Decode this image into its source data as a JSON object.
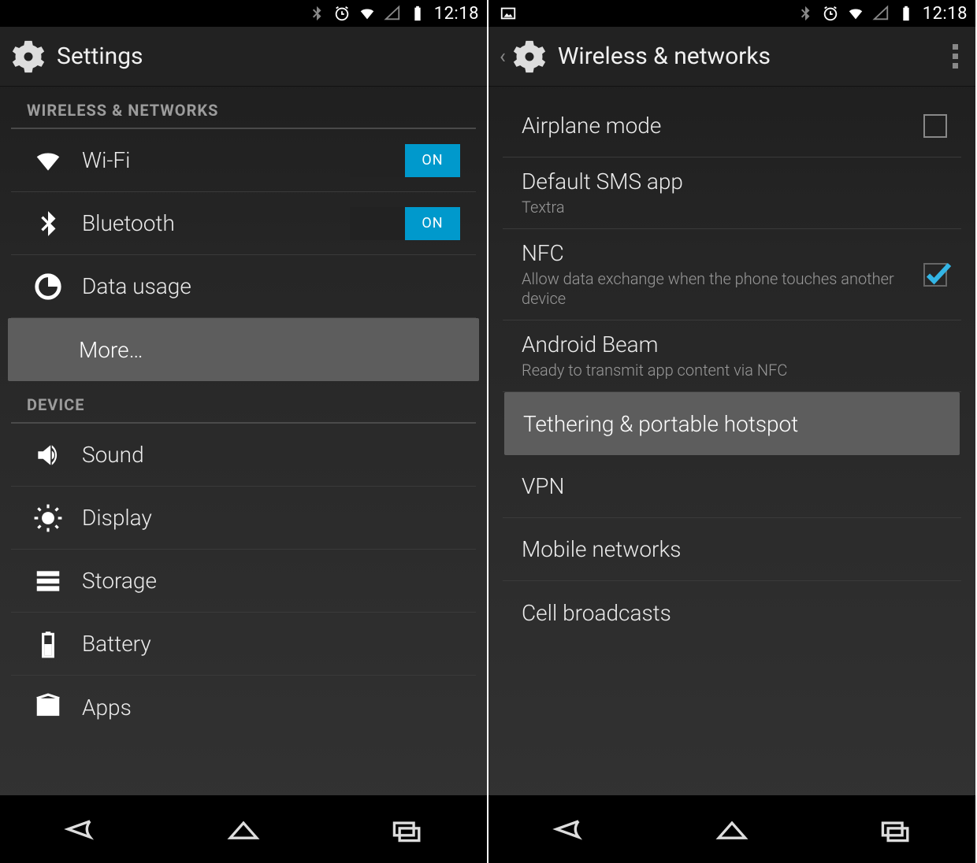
{
  "status": {
    "time": "12:18"
  },
  "left": {
    "title": "Settings",
    "section_wireless": "WIRELESS & NETWORKS",
    "section_device": "DEVICE",
    "items": {
      "wifi": "Wi-Fi",
      "bluetooth": "Bluetooth",
      "data_usage": "Data usage",
      "more": "More…",
      "sound": "Sound",
      "display": "Display",
      "storage": "Storage",
      "battery": "Battery",
      "apps": "Apps"
    },
    "toggles": {
      "wifi": "ON",
      "bluetooth": "ON"
    }
  },
  "right": {
    "title": "Wireless & networks",
    "items": {
      "airplane": {
        "label": "Airplane mode",
        "checked": false
      },
      "sms": {
        "label": "Default SMS app",
        "sub": "Textra"
      },
      "nfc": {
        "label": "NFC",
        "sub": "Allow data exchange when the phone touches another device",
        "checked": true
      },
      "beam": {
        "label": "Android Beam",
        "sub": "Ready to transmit app content via NFC"
      },
      "tether": {
        "label": "Tethering & portable hotspot"
      },
      "vpn": {
        "label": "VPN"
      },
      "mobile": {
        "label": "Mobile networks"
      },
      "cell": {
        "label": "Cell broadcasts"
      }
    }
  }
}
